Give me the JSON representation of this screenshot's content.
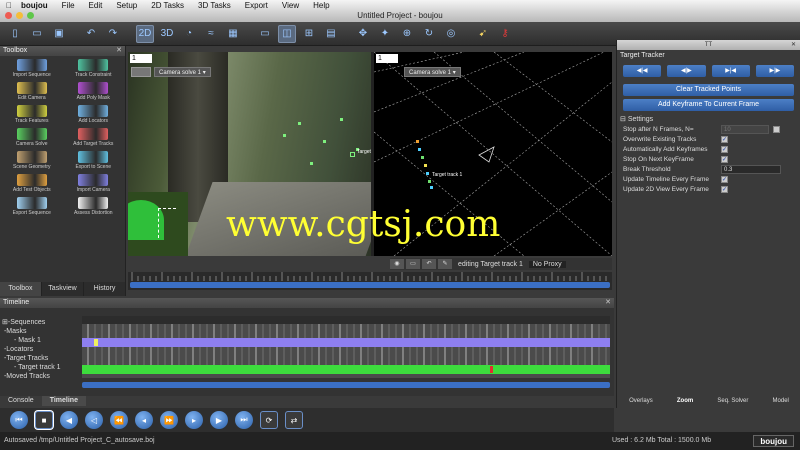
{
  "menubar": {
    "app": "boujou",
    "items": [
      "File",
      "Edit",
      "Setup",
      "2D Tasks",
      "3D Tasks",
      "Export",
      "View",
      "Help"
    ]
  },
  "window": {
    "title": "Untitled Project - boujou"
  },
  "toolbox": {
    "title": "Toolbox",
    "tools": [
      {
        "label": "Import Sequence",
        "color": "#6fa0e0"
      },
      {
        "label": "Track Constraint",
        "color": "#4fc3a0"
      },
      {
        "label": "Edit Camera",
        "color": "#e0c050"
      },
      {
        "label": "Add Poly Mask",
        "color": "#b050d0"
      },
      {
        "label": "Track Features",
        "color": "#d0d040"
      },
      {
        "label": "Add Locators",
        "color": "#70b0e0"
      },
      {
        "label": "Camera Solve",
        "color": "#5ad060"
      },
      {
        "label": "Add Target Tracks",
        "color": "#e06060"
      },
      {
        "label": "Scene Geometry",
        "color": "#c0a070"
      },
      {
        "label": "Export to Scene",
        "color": "#60c0e0"
      },
      {
        "label": "Add Test Objects",
        "color": "#e0a040"
      },
      {
        "label": "Import Camera",
        "color": "#8080e0"
      },
      {
        "label": "Export Sequence",
        "color": "#a0d0f0"
      },
      {
        "label": "Assess Distortion",
        "color": "#f0f0f0"
      }
    ],
    "tabs": [
      "Toolbox",
      "Taskview",
      "History"
    ]
  },
  "viewports": {
    "left": {
      "number": "1",
      "camera": "Camera solve 1",
      "target_label": "Target"
    },
    "right": {
      "number": "1",
      "camera": "Camera solve 1",
      "track_label": "Target track 1"
    }
  },
  "watermark": "www.cgtsj.com",
  "view_footer": {
    "editing": "editing Target track 1",
    "proxy": "No Proxy"
  },
  "timeline": {
    "title": "Timeline",
    "tree": [
      "Sequences",
      "Masks",
      "Mask 1",
      "Locators",
      "Target Tracks",
      "Target track 1",
      "Moved Tracks"
    ]
  },
  "bottom_tabs": [
    "Console",
    "Timeline"
  ],
  "transport": {
    "buttons": [
      "go-start",
      "stop",
      "step-back",
      "play-back",
      "fast-back",
      "fast-forward",
      "play-forward",
      "step-forward",
      "go-end",
      "loop",
      "bounce"
    ]
  },
  "statusbar": {
    "path": "Autosaved /tmp/Untitled Project_C_autosave.boj",
    "mem": "Used : 6.2 Mb      Total : 1500.0 Mb",
    "logo": "boujou"
  },
  "right_panel": {
    "window_label": "TT",
    "title": "Target Tracker",
    "buttons": [
      "◀|◀",
      "◀|▶",
      "▶|◀",
      "▶|▶"
    ],
    "clear_button": "Clear Tracked Points",
    "add_keyframe_button": "Add Keyframe To Current Frame",
    "settings_title": "Settings",
    "stop_after_label": "Stop after N Frames, N=",
    "stop_after_value": "10",
    "overwrite_label": "Overwrite Existing Tracks",
    "auto_add_label": "Automatically Add Keyframes",
    "stop_keyframe_label": "Stop On Next KeyFrame",
    "break_threshold_label": "Break Threshold",
    "break_threshold_value": "0.3",
    "update_timeline_label": "Update Timeline Every Frame",
    "update_2d_label": "Update 2D View Every Frame",
    "tabs": [
      "Overlays",
      "Zoom",
      "Seq. Solver",
      "Model"
    ]
  }
}
